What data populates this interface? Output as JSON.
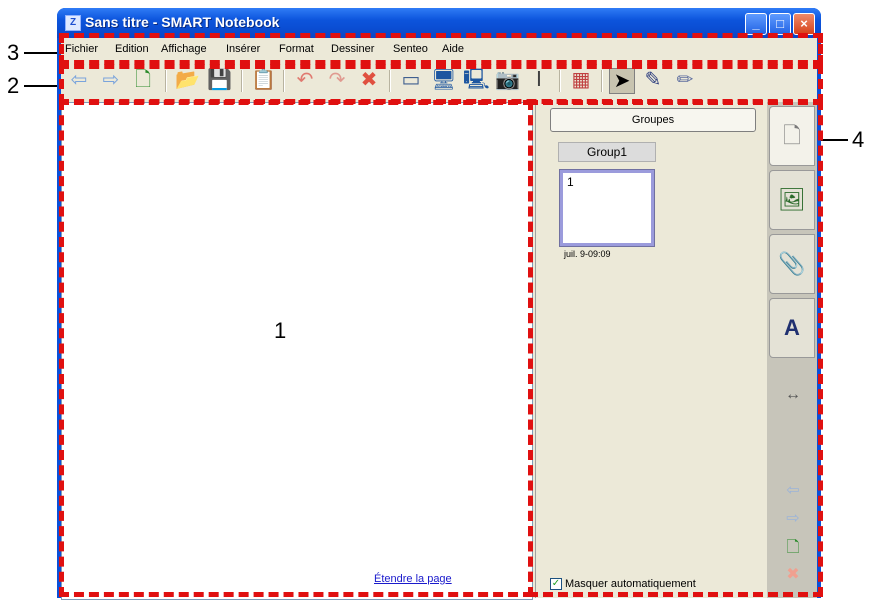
{
  "window": {
    "title": "Sans titre - SMART Notebook",
    "icon_letter": "Z"
  },
  "window_buttons": {
    "minimize": "_",
    "maximize": "□",
    "close": "×"
  },
  "menu": [
    "Fichier",
    "Edition",
    "Affichage",
    "Insérer",
    "Format",
    "Dessiner",
    "Senteo",
    "Aide"
  ],
  "toolbar": {
    "icons": [
      "back-icon",
      "forward-icon",
      "add-page-icon",
      "open-icon",
      "save-icon",
      "paste-icon",
      "undo-icon",
      "redo-icon",
      "delete-icon",
      "screen-shade-icon",
      "full-screen-icon",
      "dual-display-icon",
      "capture-icon",
      "text-icon",
      "table-icon",
      "select-icon",
      "pen-icon",
      "creative-pen-icon"
    ],
    "glyphs": [
      "⇦",
      "⇨",
      "🗋",
      "📂",
      "💾",
      "📋",
      "↶",
      "↷",
      "✖",
      "▭",
      "🖥",
      "🖳",
      "📷",
      "Ⅰ",
      "▦",
      "➤",
      "✎",
      "✏"
    ]
  },
  "page": {
    "extend_link": "Étendre la page"
  },
  "sidebar": {
    "groups_button": "Groupes",
    "group_name": "Group1",
    "thumbnail_number": "1",
    "thumbnail_date": "juil. 9-09:09",
    "autohide_label": "Masquer automatiquement",
    "autohide_checked": true
  },
  "tabs": {
    "glyphs": [
      "🗋",
      "🖼",
      "📎",
      "A"
    ],
    "resize": "↔",
    "nav": [
      "⇦",
      "⇨",
      "🗋",
      "✖"
    ]
  },
  "annotations": {
    "a1": "1",
    "a2": "2",
    "a3": "3",
    "a4": "4"
  },
  "colors": {
    "accent": "#0a4fd8",
    "dash": "#e01010"
  }
}
